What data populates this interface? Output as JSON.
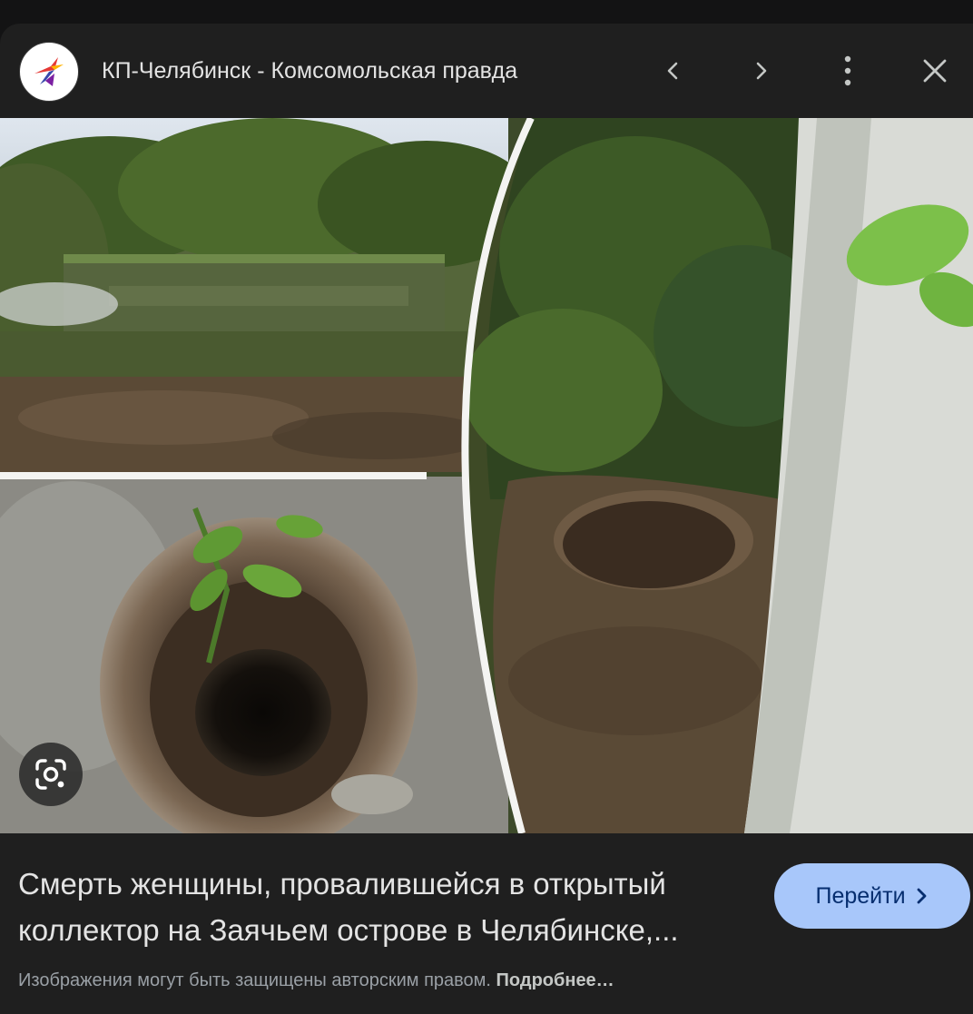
{
  "header": {
    "site_name": "КП-Челябинск - Комсомольская правда",
    "favicon_icon": "kp-bird-logo-icon",
    "prev_icon": "chevron-left-icon",
    "next_icon": "chevron-right-icon",
    "more_icon": "more-vert-icon",
    "close_icon": "close-icon"
  },
  "image": {
    "lens_icon": "google-lens-icon"
  },
  "caption": {
    "line1": "Смерть женщины, провалившейся в открытый",
    "line2": "коллектор на Заячьем острове в Челябинске,..."
  },
  "visit_button": {
    "label": "Перейти",
    "icon": "chevron-right-icon"
  },
  "copyright": {
    "notice": "Изображения могут быть защищены авторским правом.",
    "link": "Подробнее…"
  },
  "colors": {
    "background": "#131314",
    "panel": "#1f1f1f",
    "button_bg": "#a8c7fa",
    "button_text": "#062e6f",
    "text_primary": "#e3e3e3",
    "text_secondary": "#9aa0a6"
  }
}
